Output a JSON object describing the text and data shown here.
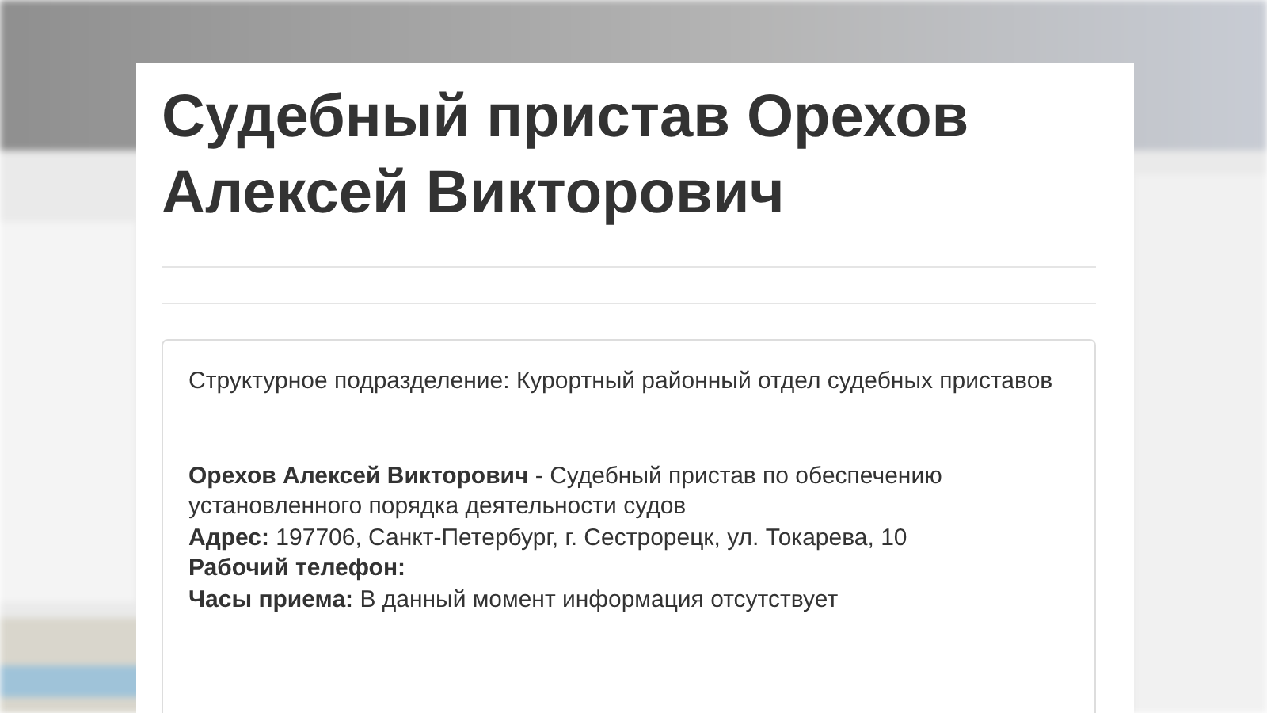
{
  "title": "Судебный пристав Орехов Алексей Викторович",
  "department": "Структурное подразделение: Курортный районный отдел судебных приставов",
  "details": [
    "**Орехов Алексей Викторович** - Судебный пристав по обеспечению установленного порядка деятельности судов",
    "**Адрес:** 197706, Санкт-Петербург, г. Сестрорецк, ул. Токарева, 10",
    "**Рабочий телефон:**",
    "**Часы приема:** В данный момент информация отсутствует"
  ]
}
